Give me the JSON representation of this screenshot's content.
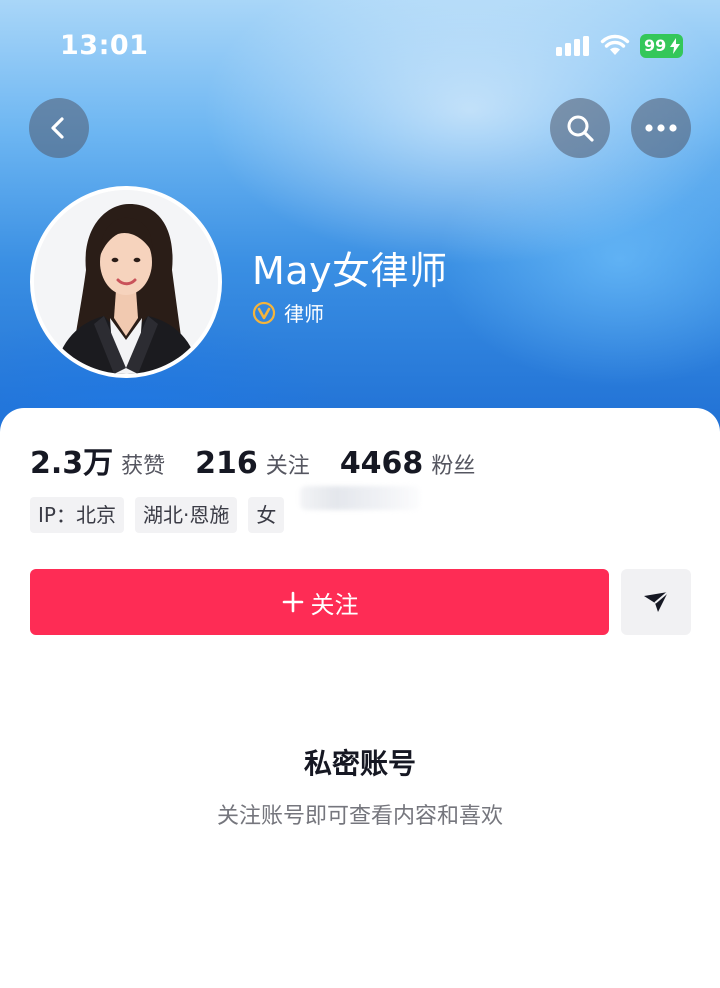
{
  "status_bar": {
    "time": "13:01",
    "battery": "99",
    "icons": [
      "signal-icon",
      "wifi-icon",
      "battery-charging-icon"
    ]
  },
  "nav": {
    "back_icon": "back-arrow-icon",
    "search_icon": "search-icon",
    "more_icon": "more-dots-icon"
  },
  "profile": {
    "name": "May女律师",
    "verified_label": "律师",
    "verified_icon": "verified-v-icon"
  },
  "stats": [
    {
      "value": "2.3万",
      "label": "获赞"
    },
    {
      "value": "216",
      "label": "关注"
    },
    {
      "value": "4468",
      "label": "粉丝"
    }
  ],
  "tags": [
    "IP：北京",
    "湖北·恩施",
    "女"
  ],
  "actions": {
    "follow_label": "关注",
    "follow_icon": "plus-icon",
    "share_icon": "send-arrow-icon"
  },
  "private": {
    "title": "私密账号",
    "subtitle": "关注账号即可查看内容和喜欢"
  },
  "colors": {
    "accent": "#fe2c55",
    "battery": "#34c759",
    "verify": "#f4b43c"
  }
}
